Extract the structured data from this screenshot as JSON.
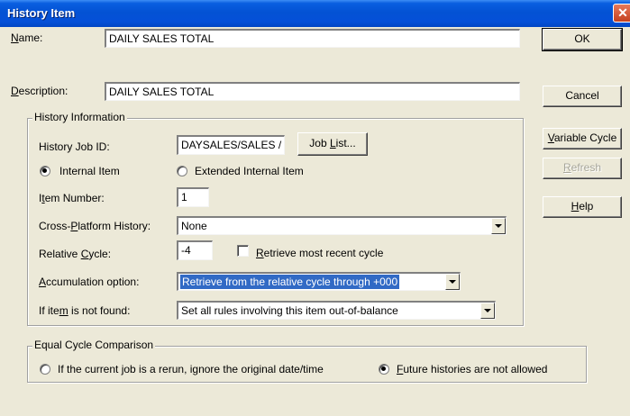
{
  "window": {
    "title": "History Item",
    "close_glyph": "✕"
  },
  "fields": {
    "name": {
      "label_key": "N",
      "label_rest": "ame:",
      "value": "DAILY SALES TOTAL"
    },
    "description": {
      "label_key": "D",
      "label_rest": "escription:",
      "value": "DAILY SALES TOTAL"
    }
  },
  "buttons": {
    "ok": "OK",
    "cancel": "Cancel",
    "variable_cycle_key": "V",
    "variable_cycle_rest": "ariable Cycle",
    "refresh_key": "R",
    "refresh_rest": "efresh",
    "help_key": "H",
    "help_rest": "elp"
  },
  "history_info": {
    "group_label": "History Information",
    "job_id_label": "History Job ID:",
    "job_id_value": "DAYSALES/SALES  /",
    "job_list_pre": "Job ",
    "job_list_key": "L",
    "job_list_post": "ist...",
    "internal_item": "Internal Item",
    "extended_internal_item": "Extended Internal Item",
    "item_number_label_pre": "I",
    "item_number_label_key": "t",
    "item_number_label_rest": "em Number:",
    "item_number_value": "1",
    "cross_platform_label_pre": "Cross-",
    "cross_platform_label_key": "P",
    "cross_platform_label_rest": "latform History:",
    "cross_platform_value": "None",
    "relative_cycle_label_pre": "Relative ",
    "relative_cycle_label_key": "C",
    "relative_cycle_label_rest": "ycle:",
    "relative_cycle_value": "-4",
    "retrieve_recent_key": "R",
    "retrieve_recent_rest": "etrieve most recent cycle",
    "accumulation_label_key": "A",
    "accumulation_label_rest": "ccumulation option:",
    "accumulation_value": "Retrieve from the relative cycle through +000",
    "not_found_label_pre": "If ite",
    "not_found_label_key": "m",
    "not_found_label_rest": " is not found:",
    "not_found_value": "Set all rules involving this item out-of-balance"
  },
  "equal_cycle": {
    "group_label": "Equal Cycle Comparison",
    "rerun_option": "If the current job is a rerun, ignore the original date/time",
    "future_key": "F",
    "future_rest": "uture histories are not allowed"
  }
}
